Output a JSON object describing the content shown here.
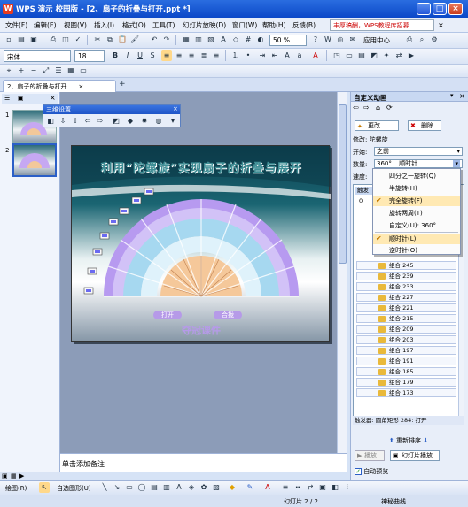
{
  "window": {
    "title": "WPS 演示 校园版 - [2、扇子的折叠与打开.ppt *]"
  },
  "menu": {
    "items": [
      "文件(F)",
      "编辑(E)",
      "视图(V)",
      "插入(I)",
      "格式(O)",
      "工具(T)",
      "幻灯片放映(D)",
      "窗口(W)",
      "帮助(H)",
      "反馈(B)"
    ],
    "promo": "丰厚稿酬，WPS教程库招募...",
    "zoom": "50 %",
    "app_center": "应用中心"
  },
  "format_toolbar": {
    "font_name": "宋体",
    "font_size": "18"
  },
  "tabs": {
    "doc_tab": "2、扇子的折叠与打开..."
  },
  "slides_panel": {
    "slide_numbers": [
      "1",
      "2"
    ]
  },
  "toolbar3d": {
    "title": "三维设置"
  },
  "slide": {
    "title": "利用“陀螺旋”实现扇子的折叠与展开",
    "btn_open": "打开",
    "btn_close": "合拢",
    "footer": "夺冠课件"
  },
  "notes": {
    "placeholder": "单击添加备注"
  },
  "taskpane": {
    "title": "自定义动画",
    "change_label": "更改",
    "delete_label": "删除",
    "modify_label": "修改: 陀螺旋",
    "start_label": "开始:",
    "start_value": "之前",
    "amount_label": "数量:",
    "amount_value": "360°",
    "direction_value": "顺时针",
    "speed_label": "速度:",
    "trigger_label": "触发器: 圆角矩形 284: 打开",
    "reorder_label": "重新排序",
    "play_label": "播放",
    "slideshow_label": "幻灯片播放",
    "autopreview_label": "自动预览",
    "list_head": "触发",
    "list_row0": "0",
    "items": [
      {
        "label": "组合 245"
      },
      {
        "label": "组合 239"
      },
      {
        "label": "组合 233"
      },
      {
        "label": "组合 227"
      },
      {
        "label": "组合 221"
      },
      {
        "label": "组合 215"
      },
      {
        "label": "组合 209"
      },
      {
        "label": "组合 203"
      },
      {
        "label": "组合 197"
      },
      {
        "label": "组合 191"
      },
      {
        "label": "组合 185"
      },
      {
        "label": "组合 179"
      },
      {
        "label": "组合 173"
      }
    ]
  },
  "dropdown": {
    "items": [
      {
        "label": "四分之一旋转(Q)",
        "checked": false
      },
      {
        "label": "半旋转(H)",
        "checked": false
      },
      {
        "label": "完全旋转(F)",
        "checked": true
      },
      {
        "label": "旋转两周(T)",
        "checked": false
      },
      {
        "label": "自定义(U):    360°",
        "checked": false
      },
      {
        "label": "顺时针(L)",
        "checked": true
      },
      {
        "label": "逆时针(O)",
        "checked": false
      }
    ]
  },
  "drawbar": {
    "draw_label": "绘图(R)",
    "autoshape_label": "自选图形(U)"
  },
  "status": {
    "slide_indicator": "幻灯片 2 / 2",
    "theme": "神秘曲线"
  }
}
